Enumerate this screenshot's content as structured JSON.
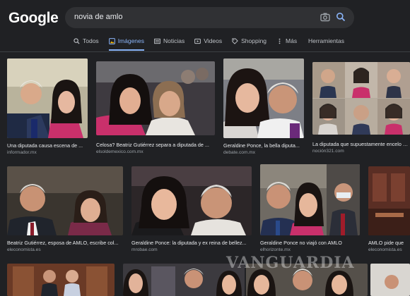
{
  "logo": "Google",
  "search": {
    "query": "novia de amlo"
  },
  "tabs": [
    {
      "label": "Todos",
      "icon": "search-icon",
      "active": false
    },
    {
      "label": "Imágenes",
      "icon": "image-icon",
      "active": true
    },
    {
      "label": "Noticias",
      "icon": "news-icon",
      "active": false
    },
    {
      "label": "Videos",
      "icon": "video-icon",
      "active": false
    },
    {
      "label": "Shopping",
      "icon": "tag-icon",
      "active": false
    },
    {
      "label": "Más",
      "icon": "more-icon",
      "active": false
    }
  ],
  "tools_label": "Herramientas",
  "results": [
    {
      "title": "Una diputada causa escena de ...",
      "source": "informador.mx"
    },
    {
      "title": "Celosa? Beatriz Gutiérrez separa a diputada de ...",
      "source": "elsoldemexico.com.mx"
    },
    {
      "title": "Geraldine Ponce, la bella diputa...",
      "source": "debate.com.mx"
    },
    {
      "title": "La diputada que supuestamente encelo a ...",
      "source": "noción321.com"
    },
    {
      "title": "Beatriz Gutiérrez, esposa de AMLO, escribe col...",
      "source": "eleconomista.es"
    },
    {
      "title": "Geraldine Ponce: la diputada y ex reina de bellez...",
      "source": "mrobae.com"
    },
    {
      "title": "Geraldine Ponce no viajó con AMLO",
      "source": "elhorizonte.mx"
    },
    {
      "title": "AMLO pide que",
      "source": "eleconomista.es"
    }
  ],
  "watermark": "VANGUARDIA"
}
